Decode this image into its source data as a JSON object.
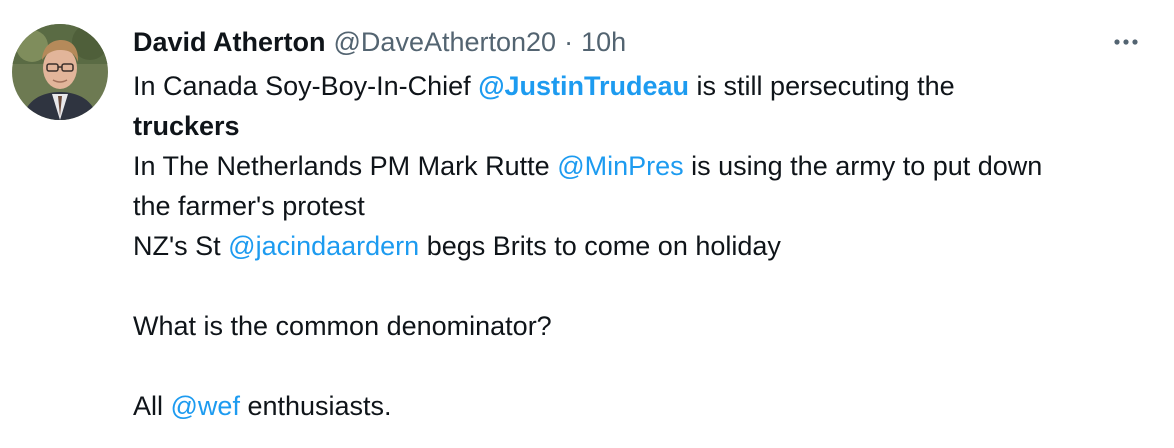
{
  "author": {
    "display_name": "David Atherton",
    "handle": "@DaveAtherton20",
    "separator": "·",
    "time": "10h"
  },
  "icons": {
    "avatar": "profile-photo",
    "more": "more-horizontal-icon"
  },
  "colors": {
    "text": "#0f1419",
    "muted": "#536471",
    "link": "#1d9bf0"
  },
  "tweet": {
    "line1": {
      "pre": "In Canada Soy-Boy-In-Chief ",
      "mention": "@JustinTrudeau",
      "post": " is still persecuting the"
    },
    "line2": {
      "bold": "truckers"
    },
    "line3": {
      "pre": "In The Netherlands PM Mark Rutte ",
      "mention": "@MinPres",
      "post": " is using the army to put down"
    },
    "line4": {
      "text": "the farmer's protest"
    },
    "line5": {
      "pre": "NZ's St ",
      "mention": "@jacindaardern",
      "post": " begs Brits to come on holiday"
    },
    "line6": {
      "text": "What is the common denominator?"
    },
    "line7": {
      "pre": "All ",
      "mention": "@wef",
      "post": " enthusiasts."
    }
  }
}
